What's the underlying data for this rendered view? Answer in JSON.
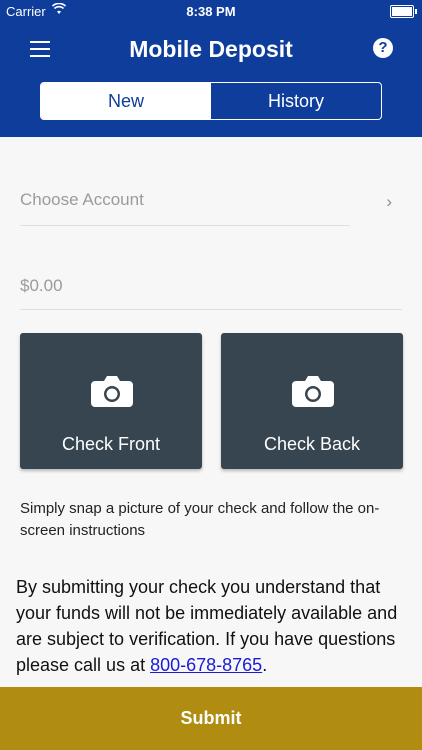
{
  "status_bar": {
    "carrier": "Carrier",
    "time": "8:38 PM"
  },
  "header": {
    "title": "Mobile Deposit"
  },
  "tabs": [
    {
      "label": "New"
    },
    {
      "label": "History"
    }
  ],
  "form": {
    "account_placeholder": "Choose Account",
    "amount_placeholder": "$0.00"
  },
  "capture": {
    "front_label": "Check Front",
    "back_label": "Check Back"
  },
  "hint": "Simply snap a picture of your check and follow the on-screen instructions",
  "notice": {
    "text": "By submitting your check you understand that your funds will not be immediately available and are subject to verification. If you have questions please call us at ",
    "phone": "800-678-8765",
    "end": "."
  },
  "submit_label": "Submit",
  "colors": {
    "header": "#0f3d9c",
    "card": "#36454f",
    "submit": "#b08c10"
  }
}
